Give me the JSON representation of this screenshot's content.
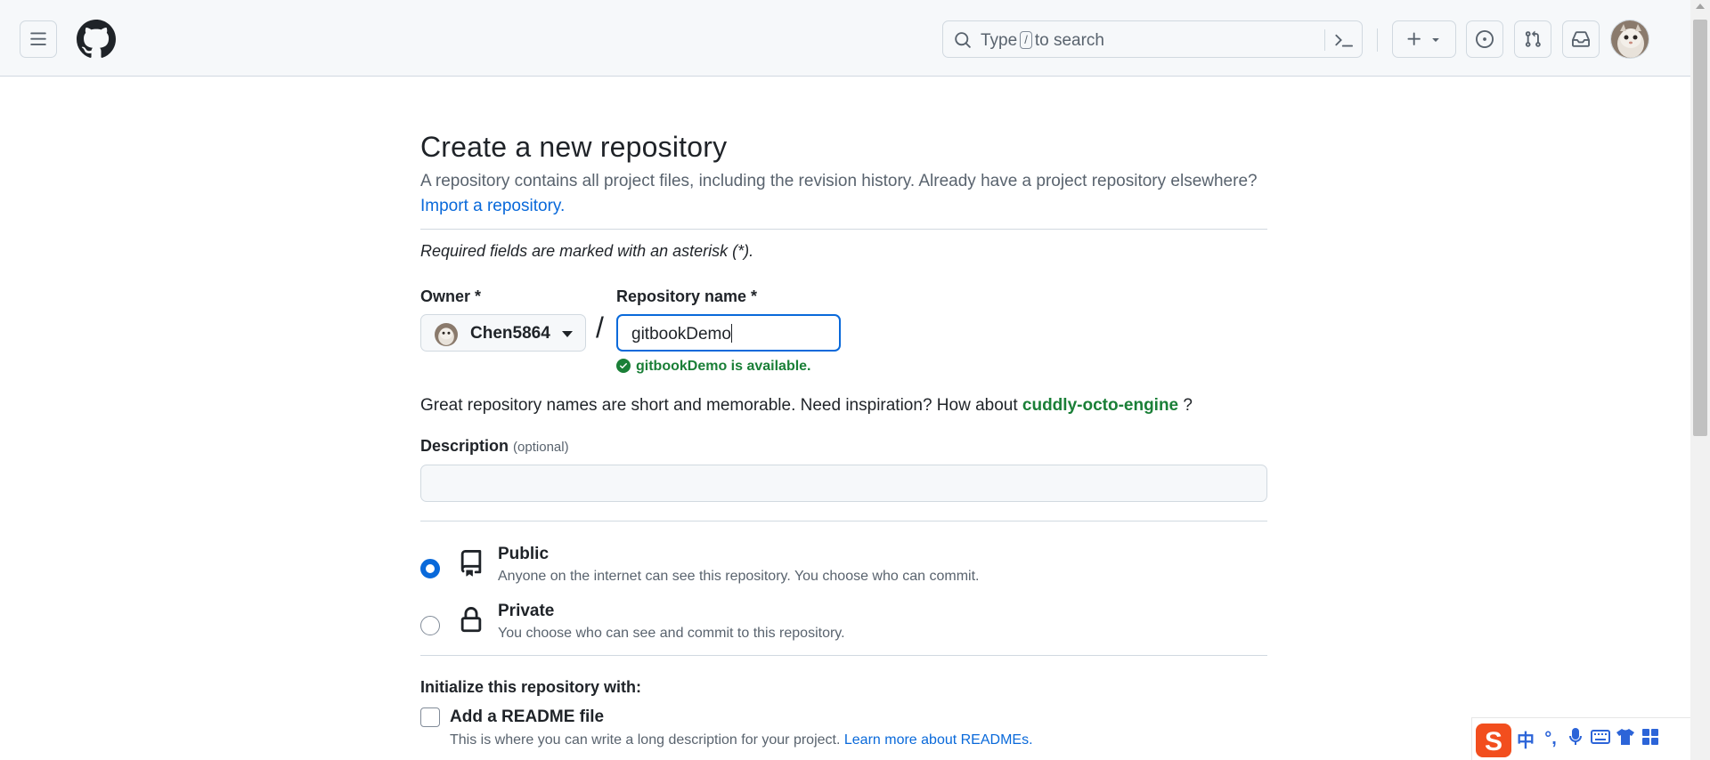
{
  "header": {
    "search_prefix": "Type",
    "search_key": "/",
    "search_suffix": "to search"
  },
  "page": {
    "title": "Create a new repository",
    "subtitle": "A repository contains all project files, including the revision history. Already have a project repository elsewhere?",
    "import_link": "Import a repository.",
    "required_note": "Required fields are marked with an asterisk (*)."
  },
  "form": {
    "owner_label": "Owner *",
    "owner_value": "Chen5864",
    "slash": "/",
    "repo_name_label": "Repository name *",
    "repo_name_value": "gitbookDemo",
    "availability": "gitbookDemo is available.",
    "inspiration_prefix": "Great repository names are short and memorable. Need inspiration? How about",
    "inspiration_suggestion": "cuddly-octo-engine",
    "inspiration_suffix": "?",
    "description_label": "Description",
    "description_optional": "(optional)",
    "description_value": ""
  },
  "visibility": {
    "selected": "Public",
    "public_title": "Public",
    "public_desc": "Anyone on the internet can see this repository. You choose who can commit.",
    "private_title": "Private",
    "private_desc": "You choose who can see and commit to this repository."
  },
  "init": {
    "label": "Initialize this repository with:",
    "readme_label": "Add a README file",
    "readme_checked": false,
    "readme_desc": "This is where you can write a long description for your project.",
    "readme_link": "Learn more about READMEs."
  },
  "ime_toolbar": {
    "items": [
      "中",
      "°,",
      "mic-icon",
      "keyboard-icon",
      "shirt-icon",
      "grid-icon"
    ]
  },
  "colors": {
    "link": "#0969da",
    "success": "#1a7f37",
    "focus": "#0969da"
  }
}
